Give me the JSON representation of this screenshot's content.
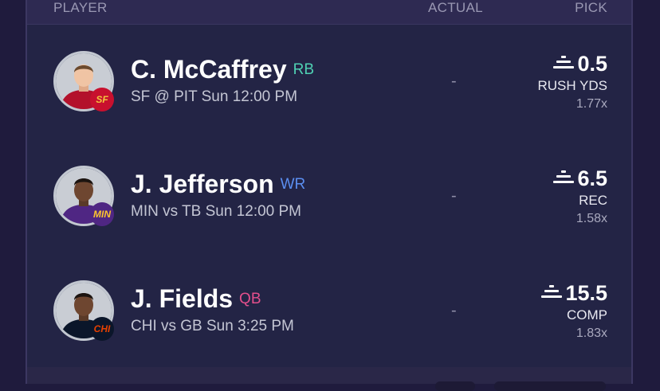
{
  "header": {
    "player_label": "PLAYER",
    "actual_label": "ACTUAL",
    "pick_label": "PICK"
  },
  "rows": [
    {
      "name": "C. McCaffrey",
      "position": "RB",
      "position_color": "#4fd1b3",
      "team": "SF",
      "team_color": "#c8102e",
      "team_text_color": "#f2c53d",
      "jersey_color": "#b3112b",
      "game": "SF @ PIT Sun 12:00 PM",
      "actual": "-",
      "pick_icon": "equal-line-icon",
      "line": "0.5",
      "stat": "RUSH YDS",
      "multiplier": "1.77x"
    },
    {
      "name": "J. Jefferson",
      "position": "WR",
      "position_color": "#5b8ef0",
      "team": "MIN",
      "team_color": "#4f2683",
      "team_text_color": "#ffc62f",
      "jersey_color": "#4f2683",
      "game": "MIN vs TB Sun 12:00 PM",
      "actual": "-",
      "pick_icon": "equal-line-icon",
      "line": "6.5",
      "stat": "REC",
      "multiplier": "1.58x"
    },
    {
      "name": "J. Fields",
      "position": "QB",
      "position_color": "#e44f8c",
      "team": "CHI",
      "team_color": "#0b162a",
      "team_text_color": "#e64100",
      "jersey_color": "#0b162a",
      "game": "CHI vs GB Sun 3:25 PM",
      "actual": "-",
      "pick_icon": "equal-line-icon",
      "line": "15.5",
      "stat": "COMP",
      "multiplier": "1.83x"
    }
  ]
}
